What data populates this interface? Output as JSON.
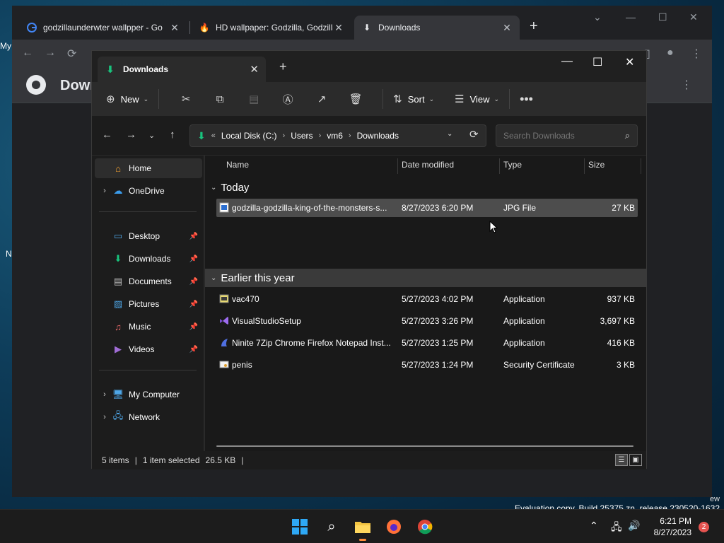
{
  "browser": {
    "tabs": [
      {
        "title": "godzillaunderwter wallpper - Go",
        "active": false
      },
      {
        "title": "HD wallpaper: Godzilla, Godzilla:",
        "active": false
      },
      {
        "title": "Downloads",
        "active": true
      }
    ],
    "page_title": "Downl"
  },
  "explorer": {
    "tab_title": "Downloads",
    "commands": {
      "new": "New",
      "sort": "Sort",
      "view": "View"
    },
    "breadcrumb": [
      "Local Disk (C:)",
      "Users",
      "vm6",
      "Downloads"
    ],
    "search_placeholder": "Search Downloads",
    "nav": {
      "home": "Home",
      "onedrive": "OneDrive",
      "pinned": [
        "Desktop",
        "Downloads",
        "Documents",
        "Pictures",
        "Music",
        "Videos"
      ],
      "my_computer": "My Computer",
      "network": "Network"
    },
    "columns": {
      "name": "Name",
      "date": "Date modified",
      "type": "Type",
      "size": "Size"
    },
    "groups": [
      {
        "label": "Today",
        "files": [
          {
            "name": "godzilla-godzilla-king-of-the-monsters-s...",
            "date": "8/27/2023 6:20 PM",
            "type": "JPG File",
            "size": "27 KB"
          }
        ]
      },
      {
        "label": "Earlier this year",
        "files": [
          {
            "name": "vac470",
            "date": "5/27/2023 4:02 PM",
            "type": "Application",
            "size": "937 KB"
          },
          {
            "name": "VisualStudioSetup",
            "date": "5/27/2023 3:26 PM",
            "type": "Application",
            "size": "3,697 KB"
          },
          {
            "name": "Ninite 7Zip Chrome Firefox Notepad Inst...",
            "date": "5/27/2023 1:25 PM",
            "type": "Application",
            "size": "416 KB"
          },
          {
            "name": "penis",
            "date": "5/27/2023 1:24 PM",
            "type": "Security Certificate",
            "size": "3 KB"
          }
        ]
      }
    ],
    "status": {
      "items": "5 items",
      "selected": "1 item selected",
      "size": "26.5 KB"
    }
  },
  "watermark": {
    "line1": "ew",
    "line2": "Evaluation copy. Build 25375.zn_release.230520-1632"
  },
  "taskbar": {
    "time": "6:21 PM",
    "date": "8/27/2023",
    "notifications": "2"
  },
  "desktop_clips": {
    "my": "My",
    "n": "N"
  },
  "colors": {
    "accent_green": "#19c37d",
    "selection": "#4d4d4d"
  }
}
